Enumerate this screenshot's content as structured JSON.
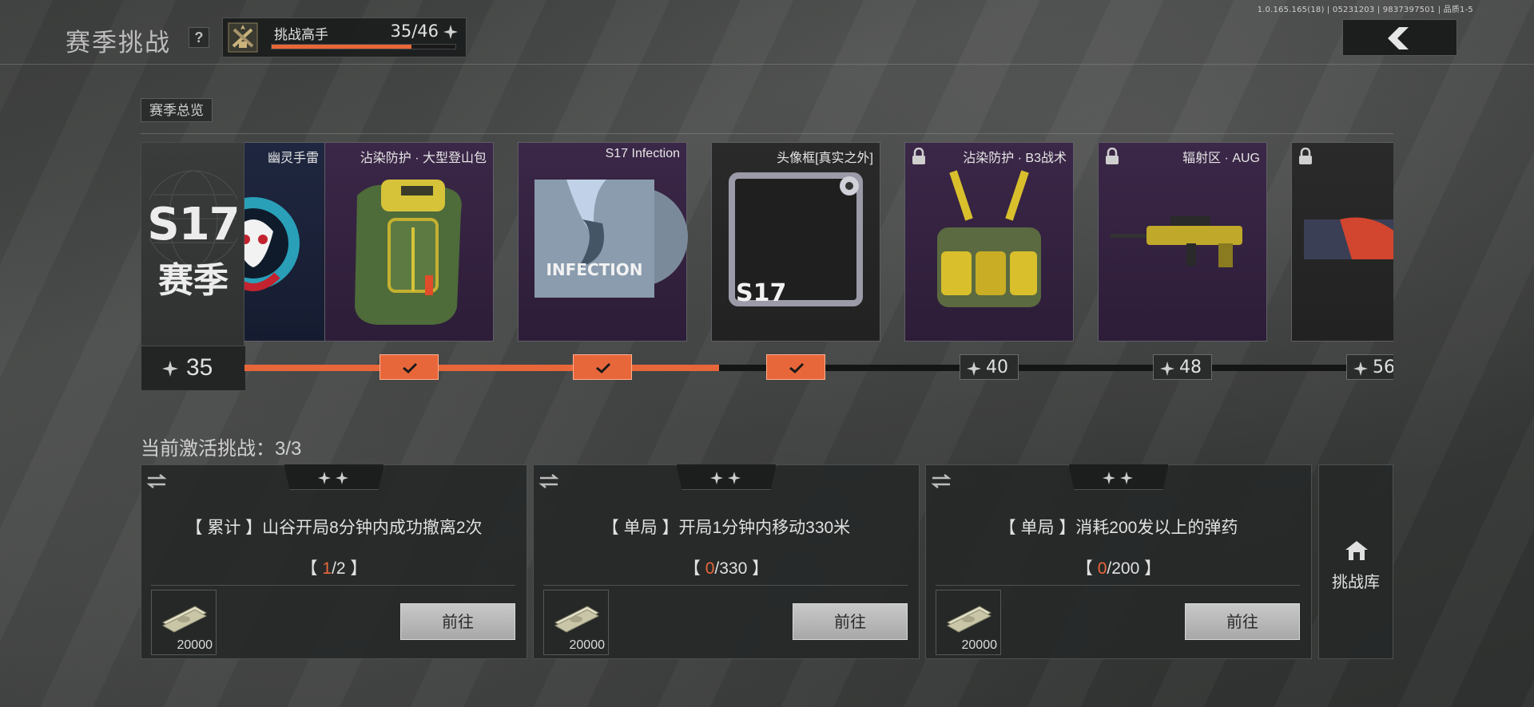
{
  "app": {
    "version": "1.0.165.165(18) | 05231203 | 9837397501 | 品质1-5",
    "title": "赛季挑战",
    "help_label": "?",
    "back_icon": "chevron-left-icon"
  },
  "rank": {
    "name": "挑战高手",
    "count": "35/46",
    "progress_fraction": 0.76,
    "emblem_icon": "crossed-guns-emblem-icon",
    "star_icon": "star-icon"
  },
  "overview": {
    "tag_label": "赛季总览",
    "season": {
      "number": "S17",
      "name": "赛季",
      "stars": "35"
    },
    "rewards": [
      {
        "label": "幽灵手雷",
        "locked": false,
        "status": "claimed",
        "stars": ""
      },
      {
        "label": "沾染防护 · 大型登山包",
        "locked": false,
        "status": "claimed",
        "stars": ""
      },
      {
        "label": "S17 Infection",
        "locked": false,
        "status": "claimed",
        "stars": ""
      },
      {
        "label": "头像框[真实之外]",
        "locked": false,
        "status": "claimed",
        "stars": ""
      },
      {
        "label": "沾染防护 · B3战术",
        "locked": true,
        "status": "locked",
        "stars": "40"
      },
      {
        "label": "辐射区 · AUG",
        "locked": true,
        "status": "locked",
        "stars": "48"
      },
      {
        "label": "",
        "locked": true,
        "status": "locked",
        "stars": "56"
      }
    ],
    "infection_text": "INFECTION",
    "frame_text": "S17"
  },
  "challenges": {
    "title": "当前激活挑战：3/3",
    "items": [
      {
        "title": "【 累计 】山谷开局8分钟内成功撤离2次",
        "open": "【 ",
        "current": "1",
        "target": "/2",
        "close": " 】",
        "reward": "20000",
        "button": "前往"
      },
      {
        "title": "【 单局 】开局1分钟内移动330米",
        "open": "【 ",
        "current": "0",
        "target": "/330",
        "close": " 】",
        "reward": "20000",
        "button": "前往"
      },
      {
        "title": "【 单局 】消耗200发以上的弹药",
        "open": "【 ",
        "current": "0",
        "target": "/200",
        "close": " 】",
        "reward": "20000",
        "button": "前往"
      }
    ],
    "library_label": "挑战库"
  },
  "colors": {
    "accent": "#e8673a",
    "card_purple": "#3b2748",
    "panel": "#262828"
  }
}
